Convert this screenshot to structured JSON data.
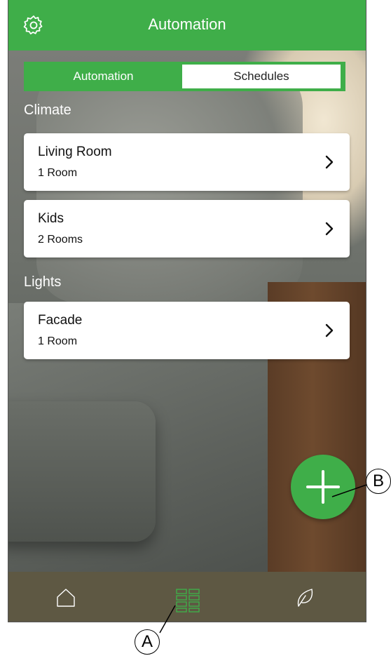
{
  "header": {
    "title": "Automation",
    "settings_icon": "gear-icon"
  },
  "segments": {
    "tab_automation": "Automation",
    "tab_schedules": "Schedules",
    "active": "Schedules"
  },
  "sections": [
    {
      "title": "Climate",
      "items": [
        {
          "name": "Living Room",
          "sub": "1 Room"
        },
        {
          "name": "Kids",
          "sub": "2 Rooms"
        }
      ]
    },
    {
      "title": "Lights",
      "items": [
        {
          "name": "Facade",
          "sub": "1 Room"
        }
      ]
    }
  ],
  "fab": {
    "icon": "plus-icon"
  },
  "bottom_nav": [
    {
      "icon": "home-icon"
    },
    {
      "icon": "grid-icon",
      "active": true
    },
    {
      "icon": "leaf-icon"
    }
  ],
  "callouts": {
    "a": "A",
    "b": "B"
  },
  "colors": {
    "brand_green": "#3fae49",
    "nav_bg": "#5e5843"
  }
}
